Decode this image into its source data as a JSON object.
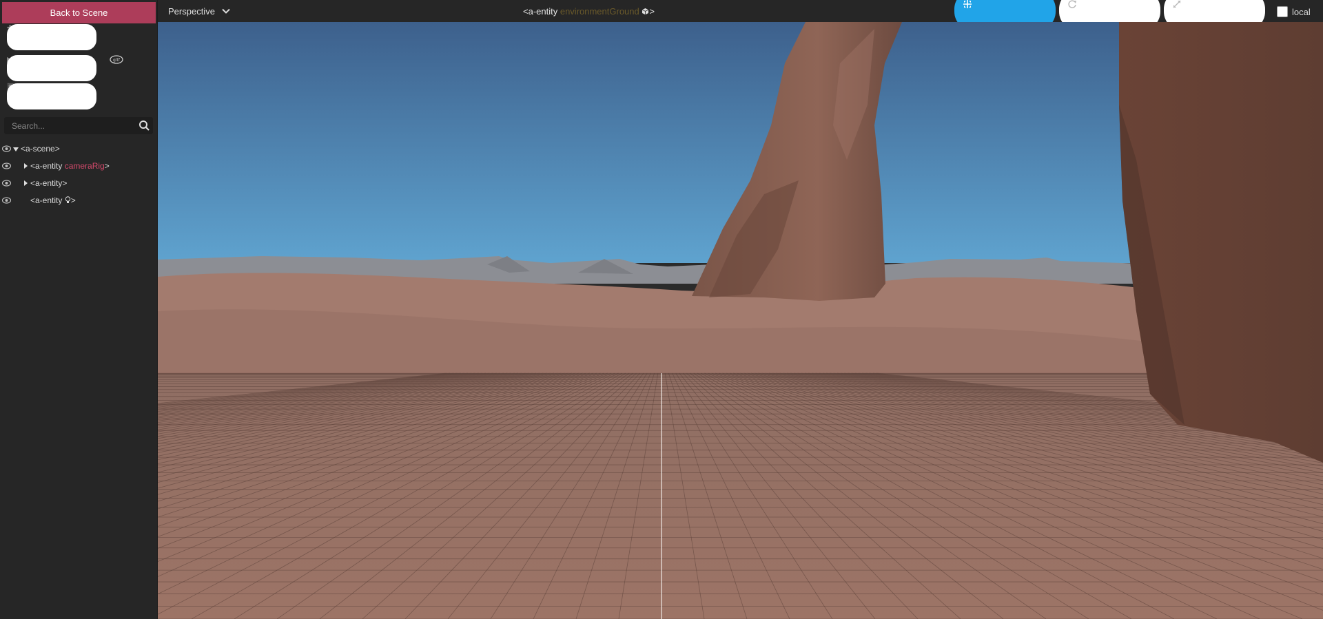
{
  "sidebar": {
    "back_label": "Back to Scene",
    "tools": [
      {
        "icon": "plus-icon"
      },
      {
        "icon": "play-icon"
      },
      {
        "icon": "image-icon"
      }
    ],
    "gltf_icon": "gltf-icon",
    "search": {
      "placeholder": "Search..."
    },
    "tree": [
      {
        "tag": "<a-scene>",
        "attr": ""
      },
      {
        "tag": "<a-entity ",
        "attr": "cameraRig",
        "end": ">"
      },
      {
        "tag": "<a-entity>",
        "attr": ""
      },
      {
        "tag": "<a-entity ",
        "attr": "",
        "end": ">",
        "icon": "lightbulb-icon"
      }
    ]
  },
  "topbar": {
    "camera": "Perspective",
    "selected_prefix": "<a-entity ",
    "selected_name": "environmentGround",
    "selected_suffix": ">",
    "local_label": "local",
    "accent": "#21a4e8"
  },
  "colors": {
    "back_button": "#ad3d5a",
    "entity_attr": "#d44a6b",
    "sky_top": "#3e6591",
    "sky_bottom": "#5b9dc9",
    "ground": "#9b7165"
  }
}
